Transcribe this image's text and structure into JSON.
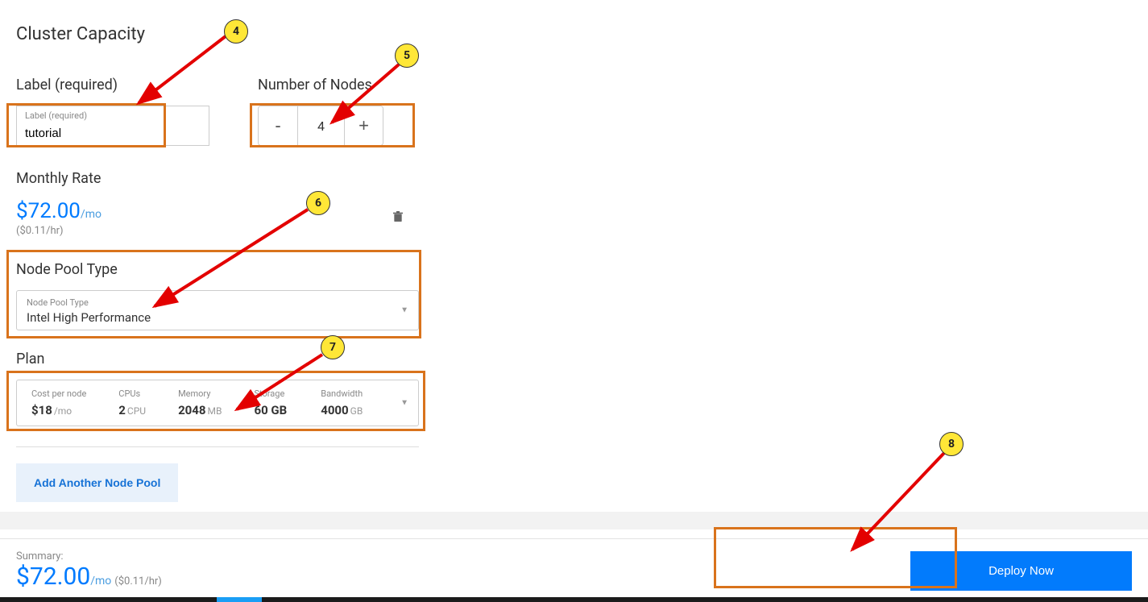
{
  "section_title": "Cluster Capacity",
  "label": {
    "heading": "Label (required)",
    "float": "Label (required)",
    "value": "tutorial"
  },
  "nodes": {
    "heading": "Number of Nodes",
    "value": "4",
    "minus": "-",
    "plus": "+"
  },
  "monthly": {
    "heading": "Monthly Rate",
    "price": "$72.00",
    "per": "/mo",
    "hr": "($0.11/hr)"
  },
  "pool": {
    "heading": "Node Pool Type",
    "float": "Node Pool Type",
    "value": "Intel High Performance"
  },
  "plan": {
    "heading": "Plan",
    "cols": [
      {
        "label": "Cost per node",
        "val": "$18",
        "unit": "/mo"
      },
      {
        "label": "CPUs",
        "val": "2",
        "unit": "CPU"
      },
      {
        "label": "Memory",
        "val": "2048",
        "unit": "MB"
      },
      {
        "label": "Storage",
        "val": "60 GB",
        "unit": ""
      },
      {
        "label": "Bandwidth",
        "val": "4000",
        "unit": "GB"
      }
    ]
  },
  "add_pool": "Add Another Node Pool",
  "footer": {
    "summary": "Summary:",
    "price": "$72.00",
    "per": "/mo",
    "hr": "($0.11/hr)",
    "deploy": "Deploy Now"
  },
  "badges": {
    "b4": "4",
    "b5": "5",
    "b6": "6",
    "b7": "7",
    "b8": "8"
  }
}
